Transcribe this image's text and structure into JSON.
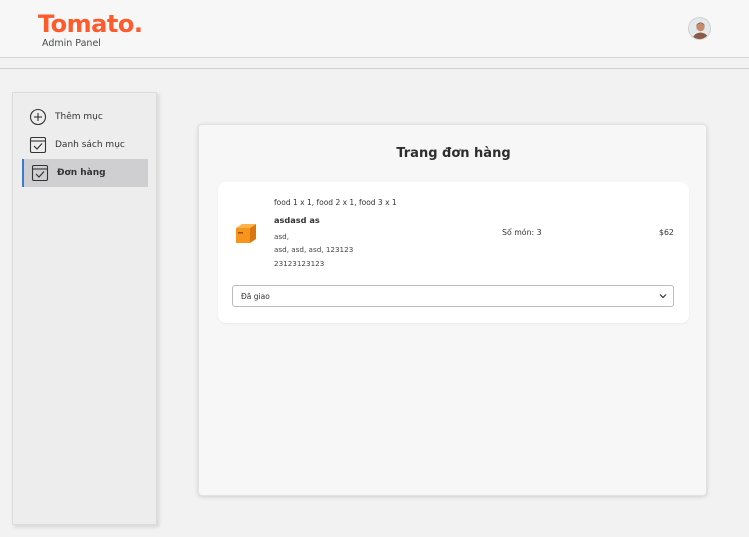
{
  "header": {
    "logo_text": "Tomato.",
    "logo_sub": "Admin Panel",
    "avatar_icon": "user-avatar"
  },
  "colors": {
    "brand": "#ff5a2c",
    "active_indicator": "#3a7bd5",
    "parcel": "#f7941d"
  },
  "sidebar": {
    "items": [
      {
        "label": "Thêm mục",
        "icon": "plus-circle-icon",
        "active": false
      },
      {
        "label": "Danh sách mục",
        "icon": "checkbox-list-icon",
        "active": false
      },
      {
        "label": "Đơn hàng",
        "icon": "checkbox-list-icon",
        "active": true
      }
    ]
  },
  "main": {
    "title": "Trang đơn hàng",
    "orders": [
      {
        "icon": "parcel-icon",
        "items": "food 1 x 1, food 2 x 1, food 3 x 1",
        "customer": "asdasd as",
        "address_line1": "asd,",
        "address_line2": "asd, asd, asd, 123123",
        "phone": "23123123123",
        "item_count": "Số món: 3",
        "total": "$62",
        "status": "Đã giao"
      }
    ]
  }
}
